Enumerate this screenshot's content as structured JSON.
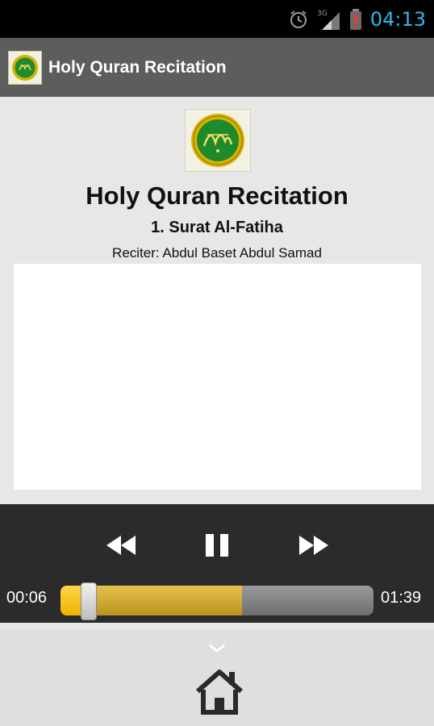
{
  "status_bar": {
    "time": "04:13",
    "network": "3G",
    "icons": [
      "alarm-icon",
      "signal-icon",
      "battery-alert-icon"
    ]
  },
  "action_bar": {
    "title": "Holy Quran Recitation",
    "logo": "quran-logo-icon"
  },
  "content": {
    "title": "Holy Quran Recitation",
    "surah": "1. Surat Al-Fatiha",
    "reciter": "Reciter: Abdul Baset Abdul Samad"
  },
  "player": {
    "current_time": "00:06",
    "total_time": "01:39",
    "progress_played": 0.09,
    "progress_buffered": 0.58,
    "controls": [
      "rewind-icon",
      "pause-icon",
      "fast-forward-icon"
    ]
  },
  "bottom": {
    "icons": [
      "chevron-down-icon",
      "home-icon"
    ]
  },
  "colors": {
    "accent": "#33b5e5",
    "seek_played": "#f0b400",
    "seek_buffered": "#c9a22e",
    "player_bg": "#2b2b2b",
    "action_bar_bg": "#5d5d5d"
  }
}
